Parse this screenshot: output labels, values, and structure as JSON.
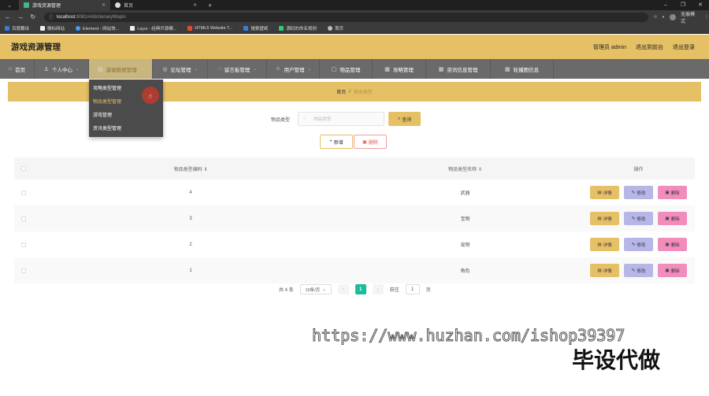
{
  "browser": {
    "tabs": [
      {
        "label": "游戏资源管理",
        "favicon_color": "#41b883",
        "active": true
      },
      {
        "label": "首页",
        "favicon_color": "#dddddd",
        "active": false
      }
    ],
    "new_tab": "+",
    "window_buttons": [
      "–",
      "❐",
      "✕"
    ],
    "url_host": "localhost",
    "url_path": ":8081/#/dictionaryWupin",
    "url_icon": "ⓘ",
    "profile": "无痕模式",
    "bookmarks": [
      {
        "label": "百度翻译",
        "color": "#3a7bd5"
      },
      {
        "label": "微标网站",
        "color": "#eeeeee"
      },
      {
        "label": "Element - 网站快...",
        "color": "#409eff"
      },
      {
        "label": "Layui - 经典开源模...",
        "color": "#eeeeee"
      },
      {
        "label": "HTML5 Website T...",
        "color": "#e44d26"
      },
      {
        "label": "搜索壁纸",
        "color": "#3b7ddd"
      },
      {
        "label": "源码的命名规则",
        "color": "#2ecc71"
      },
      {
        "label": "首页",
        "color": "#bbbbbb"
      }
    ]
  },
  "header": {
    "title": "游戏资源管理",
    "admin": "管理员 admin",
    "back_to_site": "退出到前台",
    "logout": "退出登录"
  },
  "nav": [
    {
      "label": "首页",
      "icon": "⌂",
      "caret": false,
      "active": false
    },
    {
      "label": "个人中心",
      "icon": "♙",
      "caret": true,
      "active": false
    },
    {
      "label": "基础数据管理",
      "icon": "▤",
      "caret": true,
      "active": true
    },
    {
      "label": "论坛管理",
      "icon": "◎",
      "caret": true,
      "active": false
    },
    {
      "label": "留言板管理",
      "icon": "◌",
      "caret": true,
      "active": false
    },
    {
      "label": "用户管理",
      "icon": "☺",
      "caret": true,
      "active": false
    },
    {
      "label": "物品管理",
      "icon": "▢",
      "caret": false,
      "active": false
    },
    {
      "label": "攻略管理",
      "icon": "▦",
      "caret": false,
      "active": false
    },
    {
      "label": "资讯信息管理",
      "icon": "▦",
      "caret": false,
      "active": false
    },
    {
      "label": "轮播图信息",
      "icon": "▦",
      "caret": false,
      "active": false
    }
  ],
  "dropdown": [
    "攻略类型管理",
    "物品类型管理",
    "游戏管理",
    "资讯类型管理"
  ],
  "breadcrumb": {
    "home": "首页",
    "sep": "/",
    "current": "物品类型"
  },
  "search": {
    "label": "物品类型",
    "placeholder": "物品类型",
    "query_button": "查询"
  },
  "actions": {
    "add": "新增",
    "delete": "删除"
  },
  "table": {
    "headers": {
      "code": "物品类型编码",
      "name": "物品类型名称",
      "ops": "操作"
    },
    "rows": [
      {
        "code": "4",
        "name": "武器"
      },
      {
        "code": "3",
        "name": "宝物"
      },
      {
        "code": "2",
        "name": "宠物"
      },
      {
        "code": "1",
        "name": "角色"
      }
    ],
    "op_labels": {
      "detail": "详情",
      "edit": "修改",
      "delete": "删除"
    }
  },
  "pagination": {
    "total": "共 4 条",
    "page_size": "10条/页",
    "current": "1",
    "goto_label": "前往",
    "goto_value": "1",
    "page_unit": "页"
  },
  "watermark": {
    "url": "https://www.huzhan.com/ishop39397",
    "text": "毕设代做"
  },
  "colors": {
    "accent": "#e6c065",
    "nav_bg": "#6a6a6a",
    "edit": "#b6b6e8",
    "delete": "#f28cbc",
    "pager_active": "#1abc9c"
  }
}
